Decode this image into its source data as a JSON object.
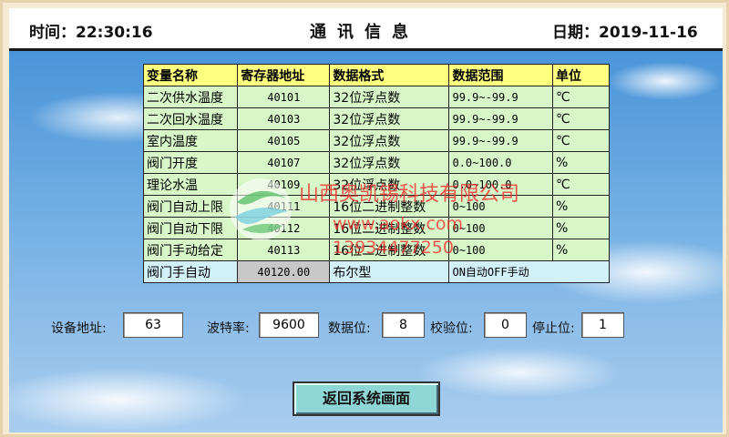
{
  "header": {
    "time_label": "时间：22:30:16",
    "title": "通讯信息",
    "date_label": "日期：2019-11-16"
  },
  "table": {
    "columns": [
      "变量名称",
      "寄存器地址",
      "数据格式",
      "数据范围",
      "单位"
    ],
    "rows": [
      [
        "二次供水温度",
        "40101",
        "32位浮点数",
        "99.9~-99.9",
        "℃"
      ],
      [
        "二次回水温度",
        "40103",
        "32位浮点数",
        "99.9~-99.9",
        "℃"
      ],
      [
        "室内温度",
        "40105",
        "32位浮点数",
        "99.9~-99.9",
        "℃"
      ],
      [
        "阀门开度",
        "40107",
        "32位浮点数",
        "0.0~100.0",
        "%"
      ],
      [
        "理论水温",
        "40109",
        "32位浮点数",
        "0.0~100.0",
        "℃"
      ],
      [
        "阀门自动上限",
        "40111",
        "16位二进制整数",
        "0~100",
        "%"
      ],
      [
        "阀门自动下限",
        "40112",
        "16位二进制整数",
        "0~100",
        "%"
      ],
      [
        "阀门手动给定",
        "40113",
        "16位二进制整数",
        "0~100",
        "%"
      ]
    ],
    "last_row": {
      "name": "阀门手自动",
      "value": "40120.00",
      "format": "布尔型",
      "range": "ON自动OFF手动"
    }
  },
  "settings": {
    "device_addr_label": "设备地址:",
    "device_addr": "63",
    "baud_label": "波特率:",
    "baud": "9600",
    "data_bits_label": "数据位:",
    "data_bits": "8",
    "parity_label": "校验位:",
    "parity": "0",
    "stop_bits_label": "停止位:",
    "stop_bits": "1"
  },
  "buttons": {
    "back_label": "返回系统画面"
  },
  "watermark": {
    "company": "山西奥凯锡科技有限公司",
    "site": "www.aokx.com",
    "phone": "13934477250"
  },
  "colors": {
    "header_bg": "#ffffff",
    "table_header_bg": "#ffff80",
    "table_cell_bg": "#d8f7c8",
    "button_bg": "#8fd6d6",
    "watermark_red": "#f02828"
  }
}
